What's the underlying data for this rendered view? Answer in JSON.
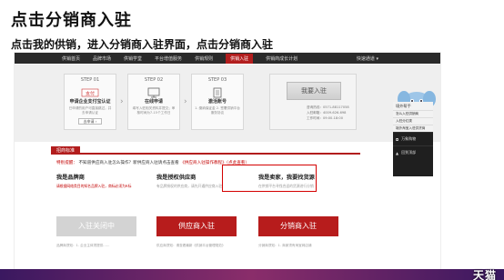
{
  "slide": {
    "title": "点击分销商入驻",
    "subtitle": "点击我的供销，进入分销商入驻界面，点击分销商入驻"
  },
  "nav": {
    "items": [
      "供销首页",
      "品牌市场",
      "供销学堂",
      "平台增值服务",
      "供销规则",
      "供销入驻",
      "供销商成长计划"
    ],
    "active_index": 5,
    "right_label": "快速通道 ▾"
  },
  "steps": [
    {
      "head": "STEP 01",
      "title": "申请企业支付宝认证",
      "desc": "已申请的用户可直接跳过，并去申请认证",
      "btn": "去申请 ›"
    },
    {
      "head": "STEP 02",
      "title": "在线申请",
      "desc": "填写入驻相关资料并提交；审核时间为7-15个工作日",
      "btn": ""
    },
    {
      "head": "STEP 03",
      "title": "激活账号",
      "desc": "1. 缴纳保证金  2. 签署供销平台服务协议",
      "btn": ""
    }
  ],
  "apply": {
    "button": "我要入驻",
    "info": [
      "咨询热线：0571-88117058",
      "入驻邮箱：4009-626-698",
      "工作时间：09:00-18:00"
    ]
  },
  "content": {
    "tab": "招商标准",
    "notice_label": "特别提醒：",
    "notice_text": "不知道供应商入驻怎么操作？新供应商入驻请点击查看",
    "notice_link": "《供应商入驻操作教程》（点此查看）",
    "columns": [
      {
        "title": "我是品牌商",
        "desc": "请根据网络类目的知名品牌入驻，商标必须为R标",
        "button": "入驻关闭中",
        "state": "disabled",
        "foot": "品牌商须知：1. 企业主体须提供……"
      },
      {
        "title": "我是授权供应商",
        "desc": "有品牌授权的供应商，请先开通供应商入驻",
        "button": "供应商入驻",
        "state": "active",
        "foot": "供应商须知：请查看最新《供销平台管理规范》"
      },
      {
        "title": "我是卖家，我要找货源",
        "desc": "在供销平台寻找合适的货源进行分销",
        "button": "分销商入驻",
        "state": "active",
        "foot": "分销商须知：1. 商家须有淘宝网店铺"
      }
    ]
  },
  "side_panel": {
    "head": "境外帮手",
    "items": [
      "怎么入驻供销商",
      "入驻分红类",
      "境外淘宝入驻供货商"
    ],
    "dark_items": [
      "万象购物",
      "回到顶部"
    ]
  },
  "brand": "天猫"
}
